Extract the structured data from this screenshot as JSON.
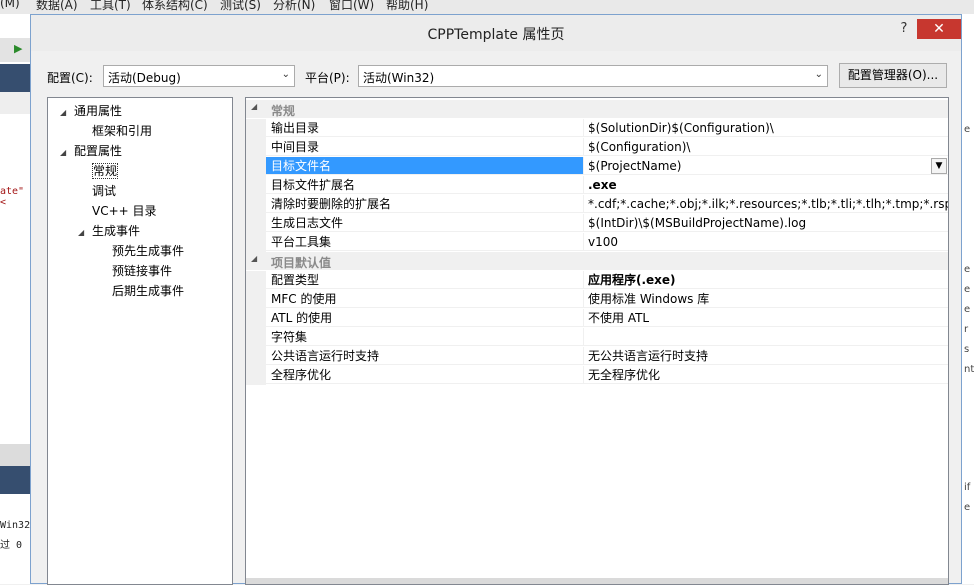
{
  "ide": {
    "menu": [
      "(M)",
      "数据(A)",
      "工具(T)",
      "体系结构(C)",
      "测试(S)",
      "分析(N)",
      "窗口(W)",
      "帮助(H)"
    ],
    "left_code": [
      "ate\"<",
      "Win32",
      "过 0"
    ],
    "right_fragments": [
      "e",
      "e",
      "e",
      "e",
      "r",
      "s",
      "nt",
      "if",
      "e"
    ]
  },
  "dialog": {
    "title": "CPPTemplate 属性页",
    "help": "?",
    "close": "✕",
    "config_label": "配置(C):",
    "config_value": "活动(Debug)",
    "platform_label": "平台(P):",
    "platform_value": "活动(Win32)",
    "manager_button": "配置管理器(O)..."
  },
  "tree": {
    "items": [
      {
        "label": "通用属性",
        "expander": "◢"
      },
      {
        "label": "框架和引用",
        "expander": ""
      },
      {
        "label": "配置属性",
        "expander": "◢"
      },
      {
        "label": "常规",
        "expander": ""
      },
      {
        "label": "调试",
        "expander": ""
      },
      {
        "label": "VC++ 目录",
        "expander": ""
      },
      {
        "label": "生成事件",
        "expander": "◢"
      },
      {
        "label": "预先生成事件",
        "expander": ""
      },
      {
        "label": "预链接事件",
        "expander": ""
      },
      {
        "label": "后期生成事件",
        "expander": ""
      }
    ]
  },
  "grid": {
    "categories": [
      {
        "label": "常规",
        "expander": "◢"
      },
      {
        "label": "项目默认值",
        "expander": "◢"
      }
    ],
    "general": [
      {
        "name": "输出目录",
        "value": "$(SolutionDir)$(Configuration)\\"
      },
      {
        "name": "中间目录",
        "value": "$(Configuration)\\"
      },
      {
        "name": "目标文件名",
        "value": "$(ProjectName)"
      },
      {
        "name": "目标文件扩展名",
        "value": ".exe"
      },
      {
        "name": "清除时要删除的扩展名",
        "value": "*.cdf;*.cache;*.obj;*.ilk;*.resources;*.tlb;*.tli;*.tlh;*.tmp;*.rsp;*.pgc"
      },
      {
        "name": "生成日志文件",
        "value": "$(IntDir)\\$(MSBuildProjectName).log"
      },
      {
        "name": "平台工具集",
        "value": "v100"
      }
    ],
    "defaults": [
      {
        "name": "配置类型",
        "value": "应用程序(.exe)"
      },
      {
        "name": "MFC 的使用",
        "value": "使用标准 Windows 库"
      },
      {
        "name": "ATL 的使用",
        "value": "不使用 ATL"
      },
      {
        "name": "字符集",
        "value": ""
      },
      {
        "name": "公共语言运行时支持",
        "value": "无公共语言运行时支持"
      },
      {
        "name": "全程序优化",
        "value": "无全程序优化"
      }
    ],
    "dropdown_arrow": "▼"
  },
  "colors": {
    "selection": "#3399ff",
    "close": "#c7372f",
    "ide_blue": "#364e6f"
  }
}
